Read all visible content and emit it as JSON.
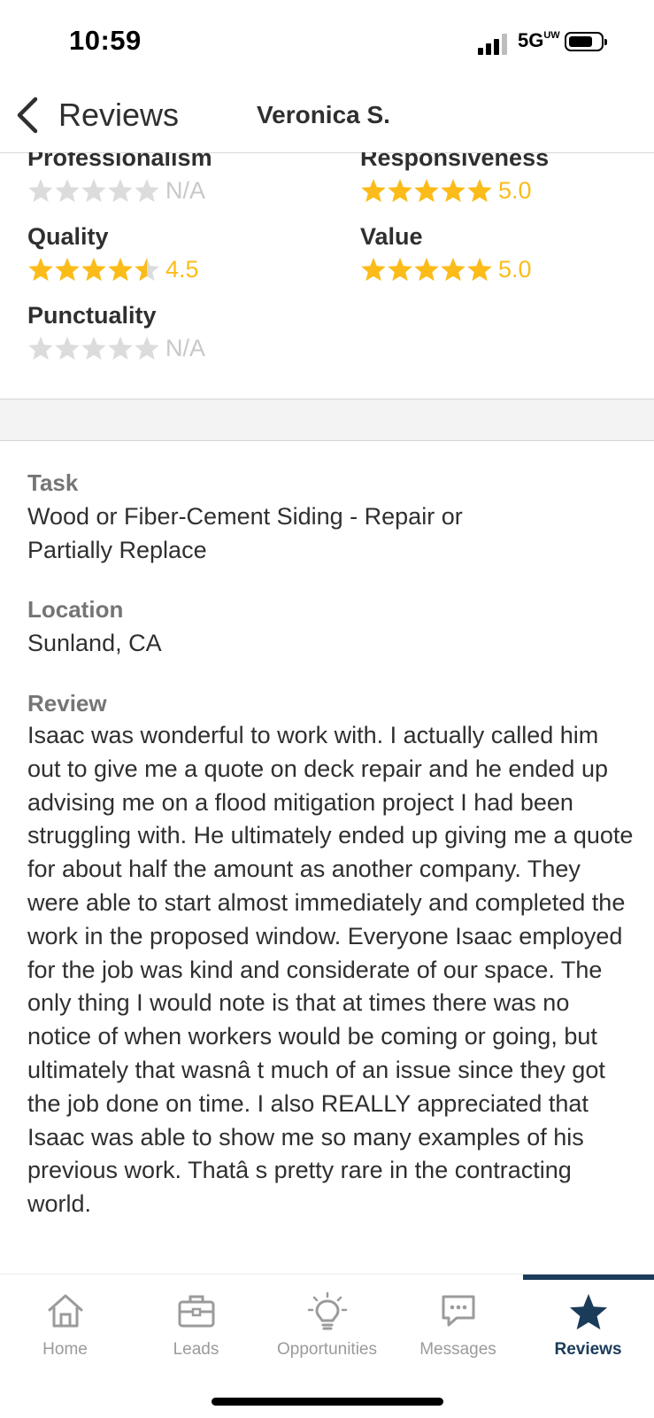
{
  "status_bar": {
    "time": "10:59",
    "network": "5G",
    "network_sup": "UW"
  },
  "header": {
    "back_label": "Reviews",
    "title": "Veronica  S."
  },
  "ratings": [
    {
      "label": "Professionalism",
      "stars": 0,
      "value": "N/A"
    },
    {
      "label": "Responsiveness",
      "stars": 5.0,
      "value": "5.0"
    },
    {
      "label": "Quality",
      "stars": 4.5,
      "value": "4.5"
    },
    {
      "label": "Value",
      "stars": 5.0,
      "value": "5.0"
    },
    {
      "label": "Punctuality",
      "stars": 0,
      "value": "N/A"
    }
  ],
  "details": {
    "task_label": "Task",
    "task_text": "Wood or Fiber-Cement Siding - Repair or Partially Replace",
    "location_label": "Location",
    "location_text": "Sunland, CA",
    "review_label": "Review",
    "review_text": "Isaac was wonderful to work with. I actually called him out to give me a quote on deck repair and he ended up advising me on a flood mitigation project I had been struggling with. He ultimately ended up giving me a quote for about half the amount as another company. They were able to start almost immediately and completed the work in the proposed window. Everyone Isaac employed for the job was kind and considerate of our space. The only thing I would note is that at times there was no notice of when workers would be coming or going, but ultimately that wasnâ  t much of an issue since they got the job done on time. I also REALLY appreciated that Isaac was able to show me so many examples of his previous work. Thatâ s pretty rare in the contracting world."
  },
  "tabs": [
    {
      "label": "Home",
      "icon": "home-icon"
    },
    {
      "label": "Leads",
      "icon": "briefcase-icon"
    },
    {
      "label": "Opportunities",
      "icon": "lightbulb-icon"
    },
    {
      "label": "Messages",
      "icon": "chat-icon"
    },
    {
      "label": "Reviews",
      "icon": "star-icon",
      "active": true
    }
  ],
  "colors": {
    "star_gold": "#fbbc1a",
    "star_empty": "#dcdcdc",
    "active_tab": "#1b3b5a",
    "inactive_tab": "#9b9b9b"
  }
}
